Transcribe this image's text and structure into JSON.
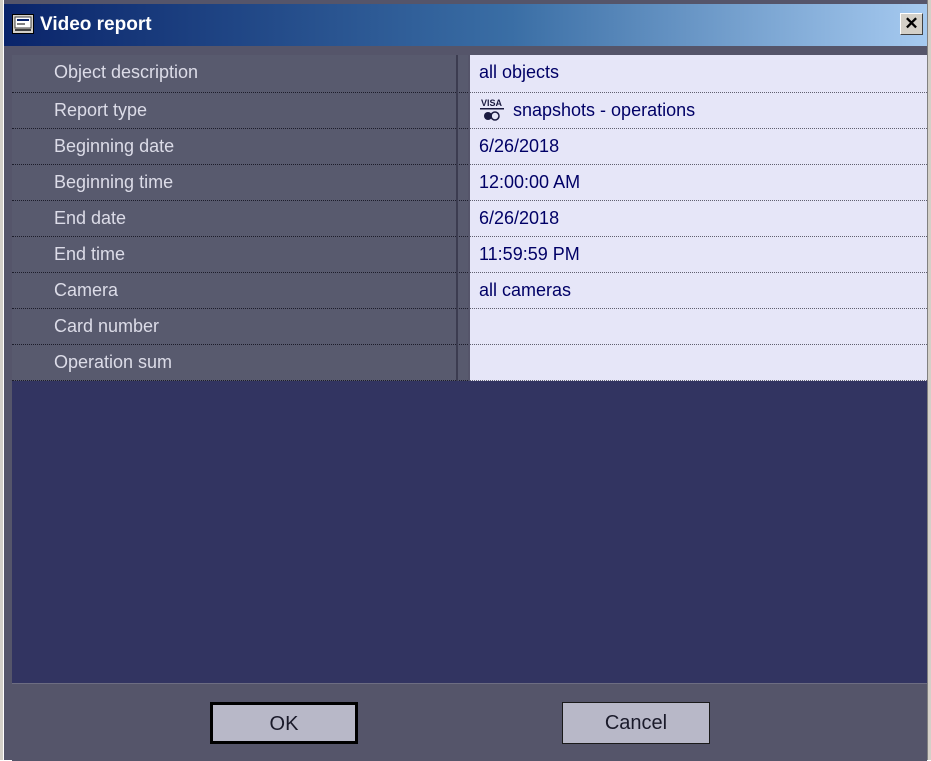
{
  "window": {
    "title": "Video report",
    "close_label": "✕"
  },
  "rows": [
    {
      "label": "Object description",
      "value": "all objects"
    },
    {
      "label": "Report type",
      "value": "snapshots - operations",
      "icon": "visa-card-icon"
    },
    {
      "label": "Beginning date",
      "value": "6/26/2018"
    },
    {
      "label": "Beginning time",
      "value": "12:00:00 AM"
    },
    {
      "label": "End date",
      "value": "6/26/2018"
    },
    {
      "label": "End time",
      "value": "11:59:59 PM"
    },
    {
      "label": "Camera",
      "value": "all cameras"
    },
    {
      "label": "Card number",
      "value": ""
    },
    {
      "label": "Operation sum",
      "value": ""
    }
  ],
  "buttons": {
    "ok_label": "OK",
    "cancel_label": "Cancel"
  },
  "colors": {
    "title_start": "#0a246a",
    "title_end": "#a6caf0",
    "panel": "#55556a",
    "list_area": "#323461",
    "value_bg": "#e6e6f8"
  }
}
